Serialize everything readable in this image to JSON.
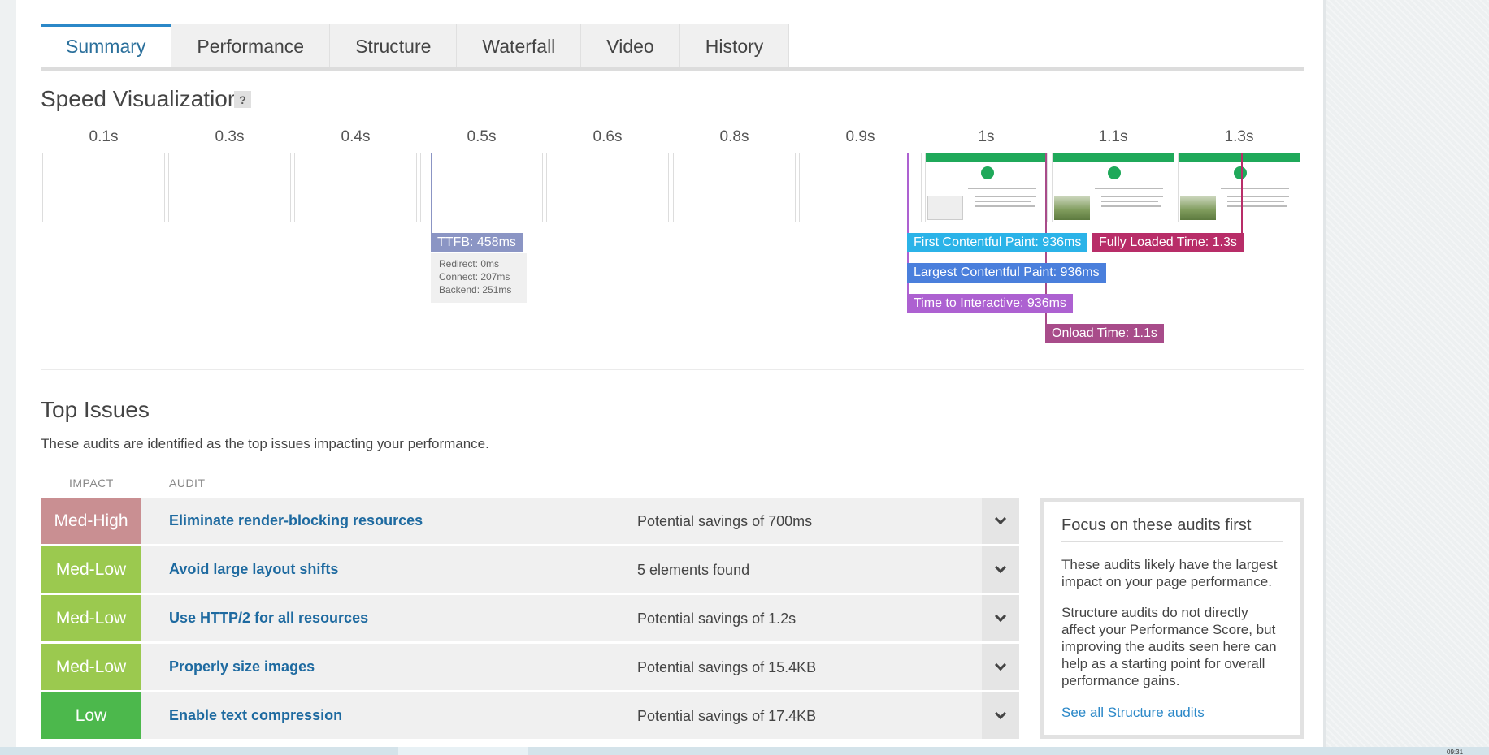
{
  "tabs": [
    {
      "label": "Summary",
      "active": true
    },
    {
      "label": "Performance"
    },
    {
      "label": "Structure"
    },
    {
      "label": "Waterfall"
    },
    {
      "label": "Video"
    },
    {
      "label": "History"
    }
  ],
  "speed": {
    "title": "Speed Visualization",
    "help": "?",
    "frames": [
      "0.1s",
      "0.3s",
      "0.4s",
      "0.5s",
      "0.6s",
      "0.8s",
      "0.9s",
      "1s",
      "1.1s",
      "1.3s"
    ],
    "ttfb": {
      "label": "TTFB: 458ms",
      "redirect": "Redirect: 0ms",
      "connect": "Connect: 207ms",
      "backend": "Backend: 251ms"
    },
    "markers": {
      "fcp": "First Contentful Paint: 936ms",
      "fully_loaded": "Fully Loaded Time: 1.3s",
      "lcp": "Largest Contentful Paint: 936ms",
      "tti": "Time to Interactive: 936ms",
      "onload": "Onload Time: 1.1s"
    },
    "colors": {
      "ttfb": "#8b95c4",
      "fcp": "#2bb3e8",
      "lcp": "#4a7fdc",
      "tti": "#ad61d1",
      "onload": "#a84c8a",
      "fully_loaded": "#b82d68"
    }
  },
  "issues": {
    "title": "Top Issues",
    "description": "These audits are identified as the top issues impacting your performance.",
    "col_impact": "IMPACT",
    "col_audit": "AUDIT",
    "rows": [
      {
        "impact": "Med-High",
        "audit": "Eliminate render-blocking resources",
        "savings": "Potential savings of 700ms",
        "color": "#c98f92"
      },
      {
        "impact": "Med-Low",
        "audit": "Avoid large layout shifts",
        "savings": "5 elements found",
        "color": "#9bc94f"
      },
      {
        "impact": "Med-Low",
        "audit": "Use HTTP/2 for all resources",
        "savings": "Potential savings of 1.2s",
        "color": "#9bc94f"
      },
      {
        "impact": "Med-Low",
        "audit": "Properly size images",
        "savings": "Potential savings of 15.4KB",
        "color": "#9bc94f"
      },
      {
        "impact": "Low",
        "audit": "Enable text compression",
        "savings": "Potential savings of 17.4KB",
        "color": "#4cb84c"
      }
    ]
  },
  "focus": {
    "title": "Focus on these audits first",
    "p1": "These audits likely have the largest impact on your page performance.",
    "p2": "Structure audits do not directly affect your Performance Score, but improving the audits seen here can help as a starting point for overall performance gains.",
    "link": "See all Structure audits"
  },
  "bottom_time": "09:31"
}
